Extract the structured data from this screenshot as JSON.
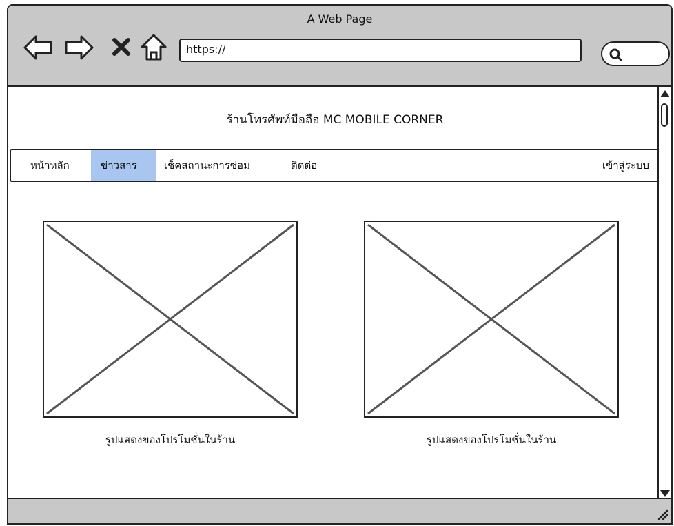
{
  "browser": {
    "window_title": "A Web Page",
    "url": "https://",
    "icons": [
      "back-arrow-icon",
      "forward-arrow-icon",
      "close-x-icon",
      "home-icon",
      "search-icon"
    ]
  },
  "page": {
    "site_title": "ร้านโทรศัพท์มือถือ MC MOBILE CORNER",
    "menu": {
      "items": [
        {
          "label": "หน้าหลัก",
          "active": false
        },
        {
          "label": "ข่าวสาร",
          "active": true
        },
        {
          "label": "เช็คสถานะการซ่อม",
          "active": false
        },
        {
          "label": "ติดต่อ",
          "active": false
        }
      ],
      "login_label": "เข้าสู่ระบบ",
      "active_color": "#a8c6f0"
    },
    "promos": [
      {
        "caption": "รูปแสดงของโปรโมชั่นในร้าน"
      },
      {
        "caption": "รูปแสดงของโปรโมชั่นในร้าน"
      }
    ]
  },
  "colors": {
    "chrome": "#c8c8c8",
    "stroke": "#222222"
  }
}
